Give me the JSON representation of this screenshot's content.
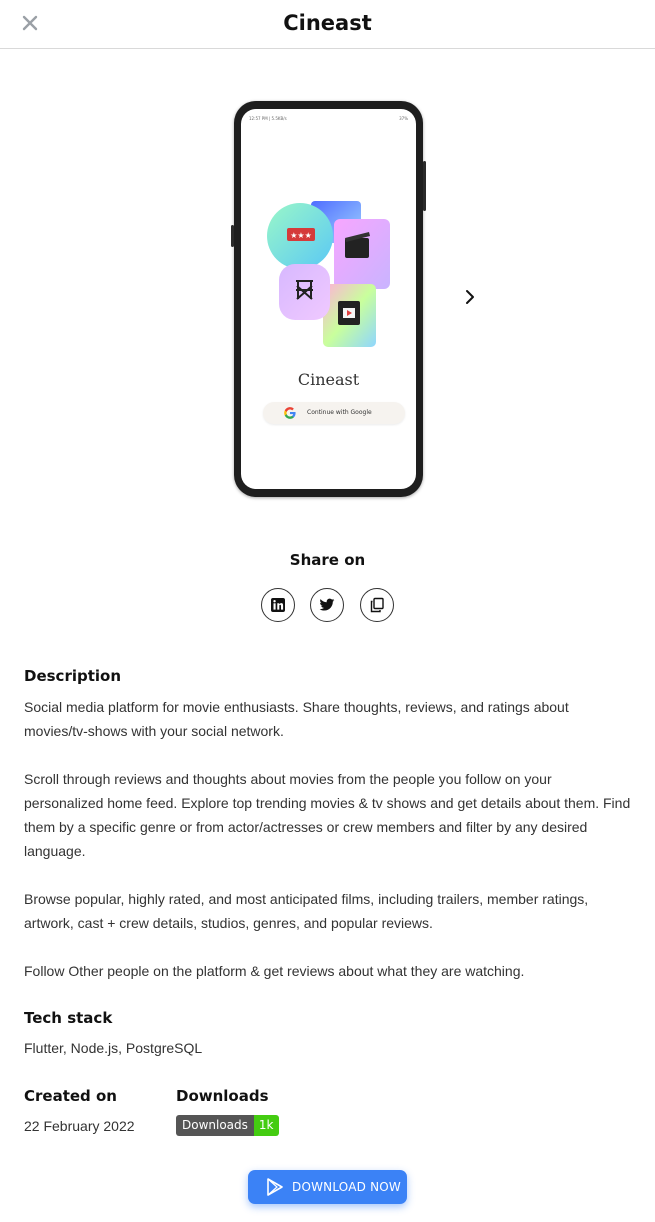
{
  "header": {
    "title": "Cineast",
    "close_icon": "close-icon"
  },
  "phone_preview": {
    "status_left": "12:57 PM | 5.5KB/s",
    "status_right": "37%",
    "app_title": "Cineast",
    "google_button": "Continue with Google",
    "next_icon": "chevron-right-icon"
  },
  "share": {
    "title": "Share on",
    "buttons": [
      "linkedin-icon",
      "twitter-icon",
      "copy-icon"
    ]
  },
  "description": {
    "title": "Description",
    "paragraphs": [
      "Social media platform for movie enthusiasts. Share thoughts, reviews, and ratings about movies/tv-shows with your social network.",
      "Scroll through reviews and thoughts about movies from the people you follow on your personalized home feed. Explore top trending movies & tv shows and get details about them. Find them by a specific genre or from actor/actresses or crew members and filter by any desired language.",
      "Browse popular, highly rated, and most anticipated films, including trailers, member ratings, artwork, cast + crew details, studios, genres, and popular reviews.",
      "Follow Other people on the platform & get reviews about what they are watching."
    ]
  },
  "tech_stack": {
    "title": "Tech stack",
    "value": "Flutter, Node.js, PostgreSQL"
  },
  "created": {
    "title": "Created on",
    "value": "22 February 2022"
  },
  "downloads": {
    "title": "Downloads",
    "badge_label": "Downloads",
    "badge_value": "1k"
  },
  "download_button": {
    "label": "DOWNLOAD NOW",
    "icon": "play-store-icon"
  },
  "colors": {
    "accent": "#3b82f6",
    "badge_gray": "#555555",
    "badge_green": "#44cc11"
  }
}
